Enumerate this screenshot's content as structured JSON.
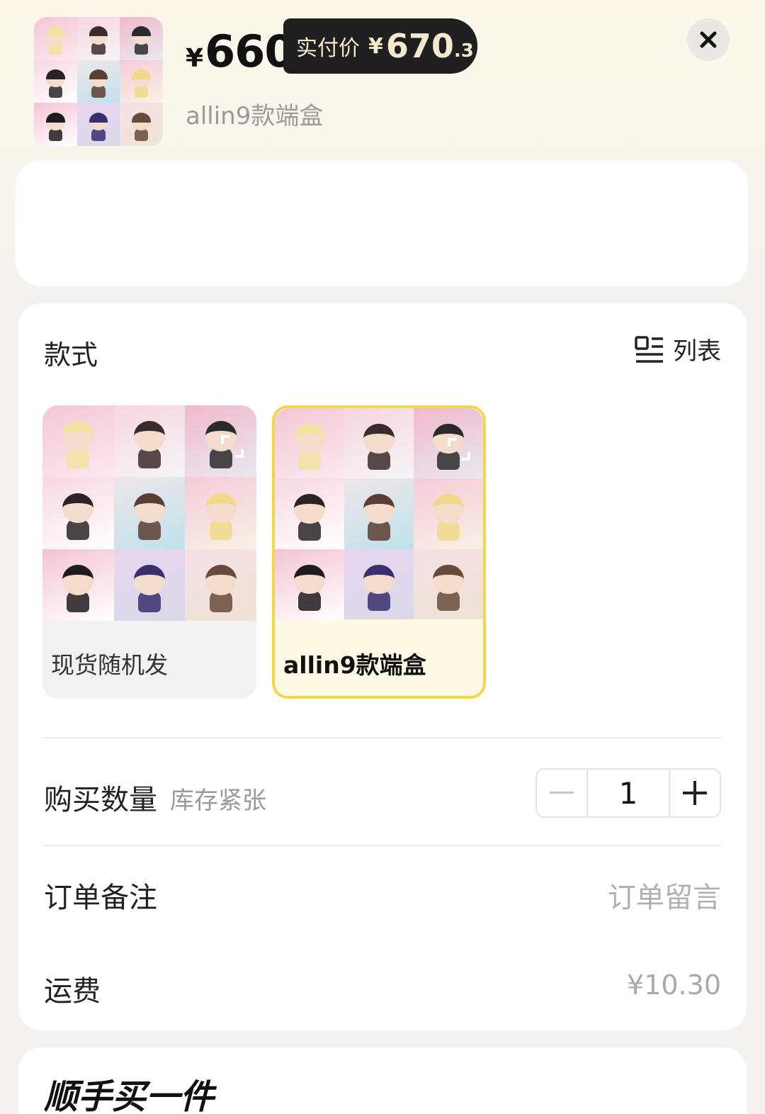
{
  "header": {
    "currency": "¥",
    "price": "660",
    "paid_label": "实付价",
    "paid_currency": "¥",
    "paid_int": "670",
    "paid_dec": ".3",
    "variant": "allin9款端盒"
  },
  "style_section": {
    "title": "款式",
    "list_label": "列表",
    "options": [
      {
        "label": "现货随机发",
        "selected": false
      },
      {
        "label": "allin9款端盒",
        "selected": true
      }
    ]
  },
  "quantity": {
    "label": "购买数量",
    "stock_note": "库存紧张",
    "value": "1",
    "minus": "−",
    "plus": "+"
  },
  "order_note": {
    "label": "订单备注",
    "placeholder": "订单留言"
  },
  "shipping": {
    "label": "运费",
    "value": "¥10.30"
  },
  "add_on": {
    "title": "顺手买一件"
  },
  "colors": {
    "accent": "#f0d84a",
    "pill_bg": "#1f1f1f",
    "pill_text": "#f2e9cf",
    "muted": "#9a9a9a"
  },
  "icons": [
    "close-icon",
    "list-view-icon",
    "expand-icon",
    "minus-icon",
    "plus-icon"
  ]
}
